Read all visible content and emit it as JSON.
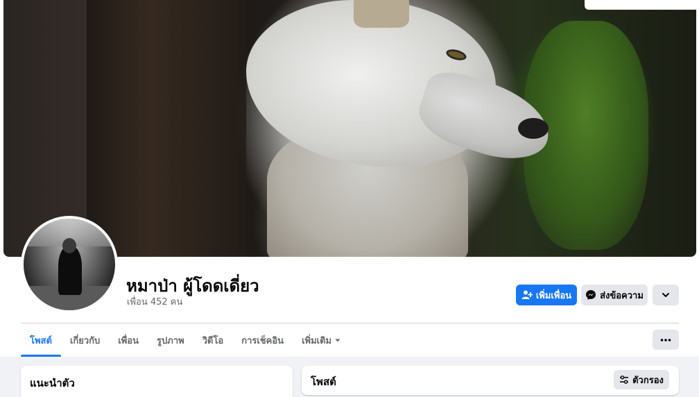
{
  "profile": {
    "name": "หมาป่า ผู้โดดเดี่ยว",
    "friends_count": "เพื่อน 452 คน"
  },
  "actions": {
    "add_friend_label": "เพิ่มเพื่อน",
    "message_label": "ส่งข้อความ",
    "more_icon": "chevron-down-icon",
    "more_options_icon": "ellipsis-icon"
  },
  "tabs": [
    {
      "label": "โพสต์",
      "active": true
    },
    {
      "label": "เกี่ยวกับ",
      "active": false
    },
    {
      "label": "เพื่อน",
      "active": false
    },
    {
      "label": "รูปภาพ",
      "active": false
    },
    {
      "label": "วิดีโอ",
      "active": false
    },
    {
      "label": "การเช็คอิน",
      "active": false
    },
    {
      "label": "เพิ่มเติม",
      "active": false
    }
  ],
  "intro": {
    "title": "แนะนำตัว"
  },
  "posts": {
    "title": "โพสต์",
    "filter_label": "ตัวกรอง"
  },
  "colors": {
    "accent": "#1877f2",
    "secondary_button": "#e4e6eb",
    "background": "#f0f2f5",
    "text_primary": "#050505",
    "text_secondary": "#65676b"
  }
}
